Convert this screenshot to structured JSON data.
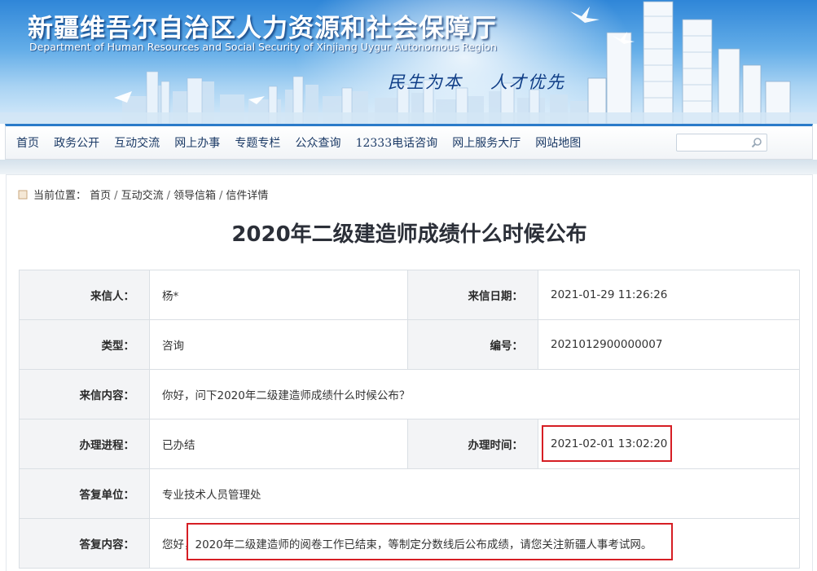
{
  "header": {
    "title_cn": "新疆维吾尔自治区人力资源和社会保障厅",
    "title_en": "Department of Human Resources and Social Security of Xinjiang Uygur Autonomous Region",
    "slogan_left": "民生为本",
    "slogan_right": "人才优先"
  },
  "nav": {
    "items": [
      "首页",
      "政务公开",
      "互动交流",
      "网上办事",
      "专题专栏",
      "公众查询",
      "12333电话咨询",
      "网上服务大厅",
      "网站地图"
    ],
    "search_placeholder": ""
  },
  "breadcrumb": {
    "prefix": "当前位置：",
    "items": [
      "首页",
      "互动交流",
      "领导信箱",
      "信件详情"
    ],
    "separator": "/"
  },
  "letter": {
    "title": "2020年二级建造师成绩什么时候公布",
    "sender_label": "来信人：",
    "sender": "杨*",
    "date_label": "来信日期：",
    "date": "2021-01-29 11:26:26",
    "type_label": "类型：",
    "type": "咨询",
    "number_label": "编号：",
    "number": "2021012900000007",
    "content_label": "来信内容：",
    "content": "你好，问下2020年二级建造师成绩什么时候公布？",
    "progress_label": "办理进程：",
    "progress": "已办结",
    "handled_time_label": "办理时间：",
    "handled_time": "2021-02-01 13:02:20",
    "reply_unit_label": "答复单位：",
    "reply_unit": "专业技术人员管理处",
    "reply_label": "答复内容：",
    "reply": "您好，2020年二级建造师的阅卷工作已结束，等制定分数线后公布成绩，请您关注新疆人事考试网。"
  },
  "colors": {
    "nav_accent": "#2b7bc9",
    "highlight_box": "#d61e24",
    "label_bg": "#f3f4f6"
  }
}
